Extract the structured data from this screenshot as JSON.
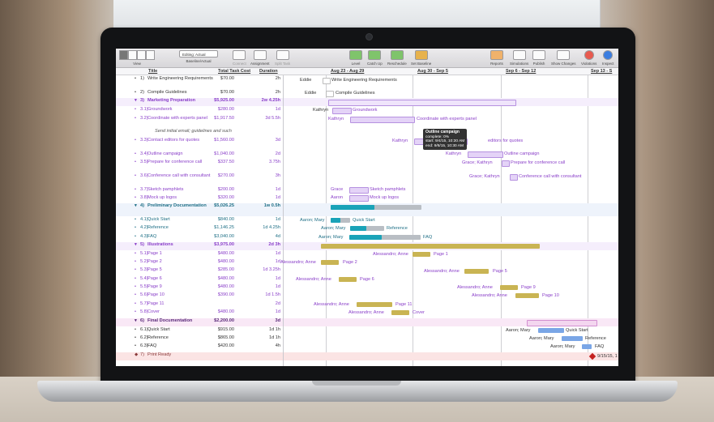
{
  "toolbar": {
    "view": "View",
    "baseline_select": "Editing: Actual",
    "baseline_label": "Baseline/Actual",
    "connect": "Connect",
    "assignment": "Assignment",
    "split_task": "Split Task",
    "level": "Level",
    "catch_up": "Catch Up",
    "reschedule": "Reschedule",
    "set_baseline": "Set Baseline",
    "reports": "Reports",
    "simulations": "Simulations",
    "publish": "Publish",
    "show_changes": "Show Changes",
    "violations": "Violations",
    "inspect": "Inspect"
  },
  "columns": {
    "title": "Title",
    "cost": "Total Task Cost",
    "duration": "Duration"
  },
  "gantt_header": {
    "w1": "Aug 23 - Aug 29",
    "w2": "Aug 30 - Sep 5",
    "w3": "Sep 6 - Sep 12",
    "w4": "Sep 13 - S"
  },
  "tasks": [
    {
      "num": "1)",
      "title": "Write Engineering Requirements",
      "cost": "$70.00",
      "dur": "2h"
    },
    {
      "num": "2)",
      "title": "Compile Guidelines",
      "cost": "$70.00",
      "dur": "2h"
    },
    {
      "num": "3)",
      "title": "Marketing Preparation",
      "cost": "$5,925.00",
      "dur": "2w 4.25h"
    },
    {
      "num": "3.1)",
      "title": "Groundwork",
      "cost": "$280.00",
      "dur": "1d"
    },
    {
      "num": "3.2)",
      "title": "Coordinate with experts panel",
      "cost": "$1,917.50",
      "dur": "3d 5.5h"
    },
    {
      "note": "Send initial email; guidelines and such"
    },
    {
      "num": "3.3)",
      "title": "Contact editors for quotes",
      "cost": "$1,560.00",
      "dur": "3d"
    },
    {
      "num": "3.4)",
      "title": "Outline campaign",
      "cost": "$1,040.00",
      "dur": "2d"
    },
    {
      "num": "3.5)",
      "title": "Prepare for conference call",
      "cost": "$337.50",
      "dur": "3.75h"
    },
    {
      "num": "3.6)",
      "title": "Conference call with consultant",
      "cost": "$270.00",
      "dur": "3h"
    },
    {
      "num": "3.7)",
      "title": "Sketch pamphlets",
      "cost": "$200.00",
      "dur": "1d"
    },
    {
      "num": "3.8)",
      "title": "Mock up logos",
      "cost": "$320.00",
      "dur": "1d"
    },
    {
      "num": "4)",
      "title": "Preliminary Documentation",
      "cost": "$5,026.25",
      "dur": "1w 0.5h"
    },
    {
      "num": "4.1)",
      "title": "Quick Start",
      "cost": "$840.00",
      "dur": "1d"
    },
    {
      "num": "4.2)",
      "title": "Reference",
      "cost": "$1,146.25",
      "dur": "1d 4.25h"
    },
    {
      "num": "4.3)",
      "title": "FAQ",
      "cost": "$3,040.00",
      "dur": "4d"
    },
    {
      "num": "5)",
      "title": "Illustrations",
      "cost": "$3,975.00",
      "dur": "2d 3h"
    },
    {
      "num": "5.1)",
      "title": "Page 1",
      "cost": "$480.00",
      "dur": "1d"
    },
    {
      "num": "5.2)",
      "title": "Page 2",
      "cost": "$480.00",
      "dur": "1d"
    },
    {
      "num": "5.3)",
      "title": "Page 5",
      "cost": "$285.00",
      "dur": "1d 3.25h"
    },
    {
      "num": "5.4)",
      "title": "Page 6",
      "cost": "$480.00",
      "dur": "1d"
    },
    {
      "num": "5.5)",
      "title": "Page 9",
      "cost": "$480.00",
      "dur": "1d"
    },
    {
      "num": "5.6)",
      "title": "Page 10",
      "cost": "$390.00",
      "dur": "1d 1.5h"
    },
    {
      "num": "5.7)",
      "title": "Page 11",
      "cost": "",
      "dur": "2d"
    },
    {
      "num": "5.8)",
      "title": "Cover",
      "cost": "$480.00",
      "dur": "1d"
    },
    {
      "num": "6)",
      "title": "Final Documentation",
      "cost": "$2,200.00",
      "dur": "3d"
    },
    {
      "num": "6.1)",
      "title": "Quick Start",
      "cost": "$915.00",
      "dur": "1d 1h"
    },
    {
      "num": "6.2)",
      "title": "Reference",
      "cost": "$865.00",
      "dur": "1d 1h"
    },
    {
      "num": "6.3)",
      "title": "FAQ",
      "cost": "$420.00",
      "dur": "4h"
    },
    {
      "num": "7)",
      "title": "Print Ready",
      "cost": "",
      "dur": ""
    }
  ],
  "gantt_labels": {
    "eddie": "Eddie",
    "kathryn": "Kathryn",
    "grace": "Grace",
    "aaron": "Aaron",
    "aaron_mary": "Aaron; Mary",
    "grace_kathryn": "Grace; Kathryn",
    "alessandro_anne": "Alessandro; Anne",
    "print_date": "9/15/15, 1"
  },
  "tooltip": {
    "title": "Outline campaign",
    "complete_k": "complete:",
    "complete_v": "0%",
    "start_k": "start:",
    "start_v": "9/4/15, 10:30 AM",
    "end_k": "end:",
    "end_v": "9/8/15, 10:30 AM"
  },
  "colors": {
    "purple": "#8a3fc9",
    "teal": "#1aa3b8",
    "gold": "#c9b453",
    "lilac": "#e4d3f7",
    "blue": "#7aa6e6",
    "red": "#c4211f"
  }
}
